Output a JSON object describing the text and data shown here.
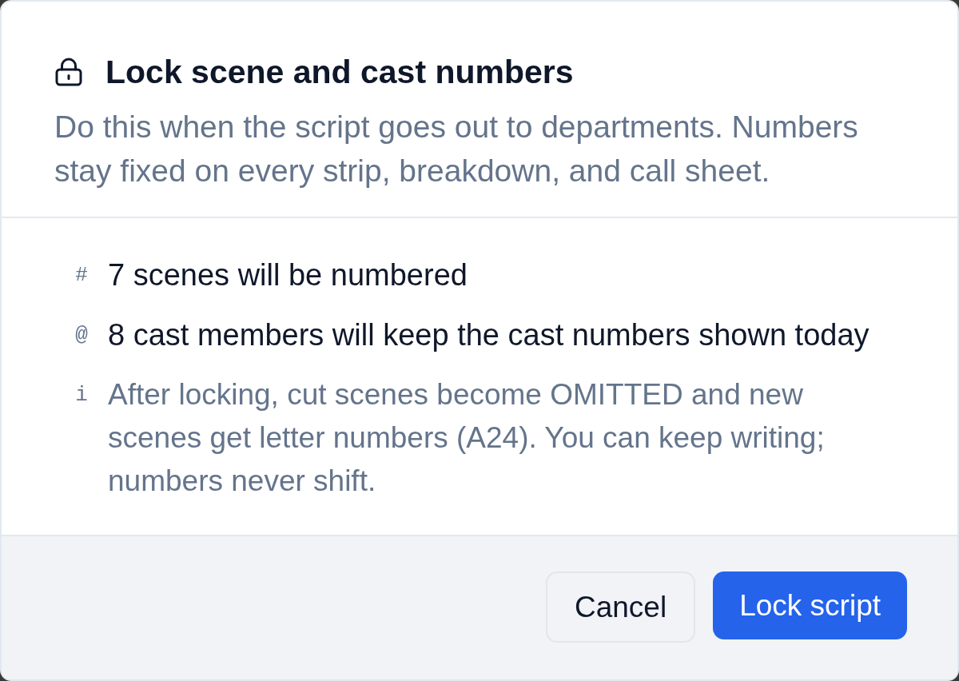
{
  "dialog": {
    "title": "Lock scene and cast numbers",
    "description": "Do this when the script goes out to departments. Numbers stay fixed on every strip, breakdown, and call sheet.",
    "items": [
      {
        "kind": "count",
        "marker": "#",
        "text": "7 scenes will be numbered"
      },
      {
        "kind": "count",
        "marker": "@",
        "text": "8 cast members will keep the cast numbers shown today"
      },
      {
        "kind": "note",
        "marker": "i",
        "text": "After locking, cut scenes become OMITTED and new scenes get letter numbers (A24). You can keep writing; numbers never shift."
      }
    ],
    "buttons": [
      {
        "kind": "secondary",
        "label": "Cancel"
      },
      {
        "kind": "primary",
        "label": "Lock script"
      }
    ]
  }
}
